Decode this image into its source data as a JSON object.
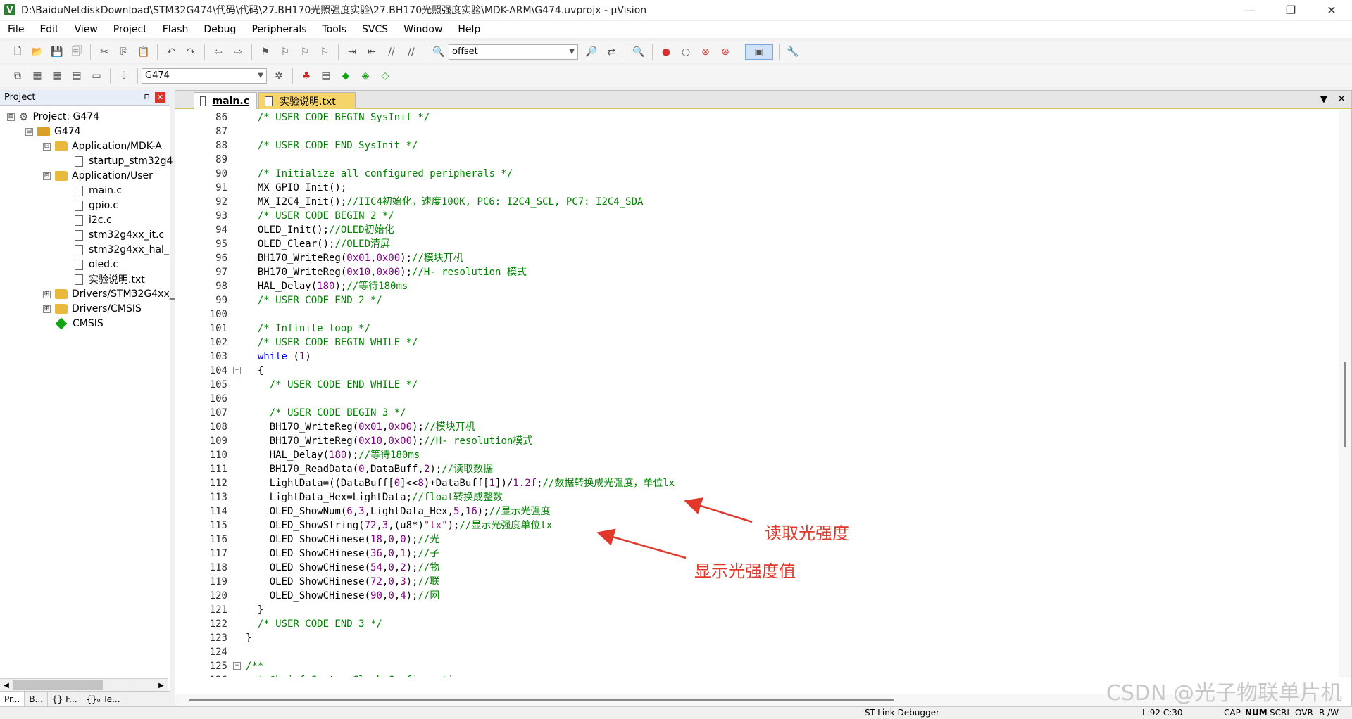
{
  "window": {
    "title": "D:\\BaiduNetdiskDownload\\STM32G474\\代码\\代码\\27.BH170光照强度实验\\27.BH170光照强度实验\\MDK-ARM\\G474.uvprojx - µVision",
    "min": "—",
    "restore": "❐",
    "close": "✕"
  },
  "menu": [
    "File",
    "Edit",
    "View",
    "Project",
    "Flash",
    "Debug",
    "Peripherals",
    "Tools",
    "SVCS",
    "Window",
    "Help"
  ],
  "toolbar": {
    "find_combo": "offset",
    "target_combo": "G474"
  },
  "project_panel": {
    "title": "Project",
    "pin": "⊓",
    "close": "✕",
    "tree": [
      {
        "label": "Project: G474",
        "level": 0,
        "kind": "root",
        "expander": "⊟"
      },
      {
        "label": "G474",
        "level": 1,
        "kind": "target",
        "expander": "⊟"
      },
      {
        "label": "Application/MDK-A",
        "level": 2,
        "kind": "folder",
        "expander": "⊟"
      },
      {
        "label": "startup_stm32g4",
        "level": 3,
        "kind": "file",
        "expander": ""
      },
      {
        "label": "Application/User",
        "level": 2,
        "kind": "folder",
        "expander": "⊟"
      },
      {
        "label": "main.c",
        "level": 3,
        "kind": "file",
        "expander": ""
      },
      {
        "label": "gpio.c",
        "level": 3,
        "kind": "file",
        "expander": ""
      },
      {
        "label": "i2c.c",
        "level": 3,
        "kind": "file",
        "expander": ""
      },
      {
        "label": "stm32g4xx_it.c",
        "level": 3,
        "kind": "file",
        "expander": ""
      },
      {
        "label": "stm32g4xx_hal_",
        "level": 3,
        "kind": "file",
        "expander": ""
      },
      {
        "label": "oled.c",
        "level": 3,
        "kind": "file",
        "expander": ""
      },
      {
        "label": "实验说明.txt",
        "level": 3,
        "kind": "file",
        "expander": ""
      },
      {
        "label": "Drivers/STM32G4xx_",
        "level": 2,
        "kind": "folder",
        "expander": "⊞"
      },
      {
        "label": "Drivers/CMSIS",
        "level": 2,
        "kind": "folder",
        "expander": "⊞"
      },
      {
        "label": "CMSIS",
        "level": 2,
        "kind": "cmsis",
        "expander": ""
      }
    ],
    "tabs": [
      "Pr...",
      "B...",
      "{} F...",
      "{}₀ Te..."
    ]
  },
  "editor": {
    "tabs": [
      {
        "label": "main.c",
        "active": true
      },
      {
        "label": "实验说明.txt",
        "active": false
      }
    ],
    "lines": [
      {
        "n": "86",
        "fold": "",
        "parts": [
          [
            "cm",
            "  /* USER CODE BEGIN SysInit */"
          ]
        ]
      },
      {
        "n": "87",
        "fold": "",
        "parts": []
      },
      {
        "n": "88",
        "fold": "",
        "parts": [
          [
            "cm",
            "  /* USER CODE END SysInit */"
          ]
        ]
      },
      {
        "n": "89",
        "fold": "",
        "parts": []
      },
      {
        "n": "90",
        "fold": "",
        "parts": [
          [
            "cm",
            "  /* Initialize all configured peripherals */"
          ]
        ]
      },
      {
        "n": "91",
        "fold": "",
        "parts": [
          [
            "t",
            "  MX_GPIO_Init();"
          ]
        ]
      },
      {
        "n": "92",
        "fold": "",
        "parts": [
          [
            "t",
            "  MX_I2C4_Init();"
          ],
          [
            "cm",
            "//IIC4初始化，速度100K, PC6: I2C4_SCL, PC7: I2C4_SDA"
          ]
        ]
      },
      {
        "n": "93",
        "fold": "",
        "parts": [
          [
            "cm",
            "  /* USER CODE BEGIN 2 */"
          ]
        ]
      },
      {
        "n": "94",
        "fold": "",
        "parts": [
          [
            "t",
            "  OLED_Init();"
          ],
          [
            "cm",
            "//OLED初始化"
          ]
        ]
      },
      {
        "n": "95",
        "fold": "",
        "parts": [
          [
            "t",
            "  OLED_Clear();"
          ],
          [
            "cm",
            "//OLED清屏"
          ]
        ]
      },
      {
        "n": "96",
        "fold": "",
        "parts": [
          [
            "t",
            "  BH170_WriteReg("
          ],
          [
            "num",
            "0x01"
          ],
          [
            "t",
            ","
          ],
          [
            "num",
            "0x00"
          ],
          [
            "t",
            ");"
          ],
          [
            "cm",
            "//模块开机"
          ]
        ]
      },
      {
        "n": "97",
        "fold": "",
        "parts": [
          [
            "t",
            "  BH170_WriteReg("
          ],
          [
            "num",
            "0x10"
          ],
          [
            "t",
            ","
          ],
          [
            "num",
            "0x00"
          ],
          [
            "t",
            ");"
          ],
          [
            "cm",
            "//H- resolution 模式"
          ]
        ]
      },
      {
        "n": "98",
        "fold": "",
        "parts": [
          [
            "t",
            "  HAL_Delay("
          ],
          [
            "num",
            "180"
          ],
          [
            "t",
            ");"
          ],
          [
            "cm",
            "//等待180ms"
          ]
        ]
      },
      {
        "n": "99",
        "fold": "",
        "parts": [
          [
            "cm",
            "  /* USER CODE END 2 */"
          ]
        ]
      },
      {
        "n": "100",
        "fold": "",
        "parts": []
      },
      {
        "n": "101",
        "fold": "",
        "parts": [
          [
            "cm",
            "  /* Infinite loop */"
          ]
        ]
      },
      {
        "n": "102",
        "fold": "",
        "parts": [
          [
            "cm",
            "  /* USER CODE BEGIN WHILE */"
          ]
        ]
      },
      {
        "n": "103",
        "fold": "",
        "parts": [
          [
            "kw",
            "  while"
          ],
          [
            "t",
            " ("
          ],
          [
            "num",
            "1"
          ],
          [
            "t",
            ")"
          ]
        ]
      },
      {
        "n": "104",
        "fold": "⊟",
        "parts": [
          [
            "t",
            "  {"
          ]
        ]
      },
      {
        "n": "105",
        "fold": "|",
        "parts": [
          [
            "cm",
            "    /* USER CODE END WHILE */"
          ]
        ]
      },
      {
        "n": "106",
        "fold": "|",
        "parts": []
      },
      {
        "n": "107",
        "fold": "|",
        "parts": [
          [
            "cm",
            "    /* USER CODE BEGIN 3 */"
          ]
        ]
      },
      {
        "n": "108",
        "fold": "|",
        "parts": [
          [
            "t",
            "    BH170_WriteReg("
          ],
          [
            "num",
            "0x01"
          ],
          [
            "t",
            ","
          ],
          [
            "num",
            "0x00"
          ],
          [
            "t",
            ");"
          ],
          [
            "cm",
            "//模块开机"
          ]
        ]
      },
      {
        "n": "109",
        "fold": "|",
        "parts": [
          [
            "t",
            "    BH170_WriteReg("
          ],
          [
            "num",
            "0x10"
          ],
          [
            "t",
            ","
          ],
          [
            "num",
            "0x00"
          ],
          [
            "t",
            ");"
          ],
          [
            "cm",
            "//H- resolution模式"
          ]
        ]
      },
      {
        "n": "110",
        "fold": "|",
        "parts": [
          [
            "t",
            "    HAL_Delay("
          ],
          [
            "num",
            "180"
          ],
          [
            "t",
            ");"
          ],
          [
            "cm",
            "//等待180ms"
          ]
        ]
      },
      {
        "n": "111",
        "fold": "|",
        "parts": [
          [
            "t",
            "    BH170_ReadData("
          ],
          [
            "num",
            "0"
          ],
          [
            "t",
            ",DataBuff,"
          ],
          [
            "num",
            "2"
          ],
          [
            "t",
            ");"
          ],
          [
            "cm",
            "//读取数据"
          ]
        ]
      },
      {
        "n": "112",
        "fold": "|",
        "parts": [
          [
            "t",
            "    LightData=((DataBuff["
          ],
          [
            "num",
            "0"
          ],
          [
            "t",
            "]<<"
          ],
          [
            "num",
            "8"
          ],
          [
            "t",
            ")+DataBuff["
          ],
          [
            "num",
            "1"
          ],
          [
            "t",
            "])/"
          ],
          [
            "num",
            "1.2f"
          ],
          [
            "t",
            ";"
          ],
          [
            "cm",
            "//数据转换成光强度，单位lx"
          ]
        ]
      },
      {
        "n": "113",
        "fold": "|",
        "parts": [
          [
            "t",
            "    LightData_Hex=LightData;"
          ],
          [
            "cm",
            "//float转换成整数"
          ]
        ]
      },
      {
        "n": "114",
        "fold": "|",
        "parts": [
          [
            "t",
            "    OLED_ShowNum("
          ],
          [
            "num",
            "6"
          ],
          [
            "t",
            ","
          ],
          [
            "num",
            "3"
          ],
          [
            "t",
            ",LightData_Hex,"
          ],
          [
            "num",
            "5"
          ],
          [
            "t",
            ","
          ],
          [
            "num",
            "16"
          ],
          [
            "t",
            ");"
          ],
          [
            "cm",
            "//显示光强度"
          ]
        ]
      },
      {
        "n": "115",
        "fold": "|",
        "parts": [
          [
            "t",
            "    OLED_ShowString("
          ],
          [
            "num",
            "72"
          ],
          [
            "t",
            ","
          ],
          [
            "num",
            "3"
          ],
          [
            "t",
            ",(u8*)"
          ],
          [
            "str",
            "\"lx\""
          ],
          [
            "t",
            ");"
          ],
          [
            "cm",
            "//显示光强度单位lx"
          ]
        ]
      },
      {
        "n": "116",
        "fold": "|",
        "parts": [
          [
            "t",
            "    OLED_ShowCHinese("
          ],
          [
            "num",
            "18"
          ],
          [
            "t",
            ","
          ],
          [
            "num",
            "0"
          ],
          [
            "t",
            ","
          ],
          [
            "num",
            "0"
          ],
          [
            "t",
            ");"
          ],
          [
            "cm",
            "//光"
          ]
        ]
      },
      {
        "n": "117",
        "fold": "|",
        "parts": [
          [
            "t",
            "    OLED_ShowCHinese("
          ],
          [
            "num",
            "36"
          ],
          [
            "t",
            ","
          ],
          [
            "num",
            "0"
          ],
          [
            "t",
            ","
          ],
          [
            "num",
            "1"
          ],
          [
            "t",
            ");"
          ],
          [
            "cm",
            "//子"
          ]
        ]
      },
      {
        "n": "118",
        "fold": "|",
        "parts": [
          [
            "t",
            "    OLED_ShowCHinese("
          ],
          [
            "num",
            "54"
          ],
          [
            "t",
            ","
          ],
          [
            "num",
            "0"
          ],
          [
            "t",
            ","
          ],
          [
            "num",
            "2"
          ],
          [
            "t",
            ");"
          ],
          [
            "cm",
            "//物"
          ]
        ]
      },
      {
        "n": "119",
        "fold": "|",
        "parts": [
          [
            "t",
            "    OLED_ShowCHinese("
          ],
          [
            "num",
            "72"
          ],
          [
            "t",
            ","
          ],
          [
            "num",
            "0"
          ],
          [
            "t",
            ","
          ],
          [
            "num",
            "3"
          ],
          [
            "t",
            ");"
          ],
          [
            "cm",
            "//联"
          ]
        ]
      },
      {
        "n": "120",
        "fold": "|",
        "parts": [
          [
            "t",
            "    OLED_ShowCHinese("
          ],
          [
            "num",
            "90"
          ],
          [
            "t",
            ","
          ],
          [
            "num",
            "0"
          ],
          [
            "t",
            ","
          ],
          [
            "num",
            "4"
          ],
          [
            "t",
            ");"
          ],
          [
            "cm",
            "//网"
          ]
        ]
      },
      {
        "n": "121",
        "fold": "└",
        "parts": [
          [
            "t",
            "  }"
          ]
        ]
      },
      {
        "n": "122",
        "fold": "",
        "parts": [
          [
            "cm",
            "  /* USER CODE END 3 */"
          ]
        ]
      },
      {
        "n": "123",
        "fold": "",
        "parts": [
          [
            "t",
            "}"
          ]
        ]
      },
      {
        "n": "124",
        "fold": "",
        "parts": []
      },
      {
        "n": "125",
        "fold": "⊟",
        "parts": [
          [
            "cm",
            "/**"
          ]
        ]
      },
      {
        "n": "126",
        "fold": "",
        "parts": [
          [
            "cm",
            "  * @brief System Clock Configuration"
          ]
        ]
      }
    ]
  },
  "annotations": {
    "read_intensity": "读取光强度",
    "show_value": "显示光强度值",
    "color": "#e0392b"
  },
  "watermark": "CSDN @光子物联单片机",
  "status": {
    "debugger": "ST-Link Debugger",
    "position": "L:92 C:30",
    "caps": "CAP",
    "num": "NUM",
    "scrl": "SCRL",
    "ovr": "OVR",
    "rw": "R /W"
  }
}
